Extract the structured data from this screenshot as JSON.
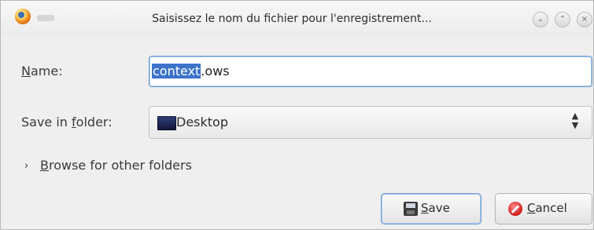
{
  "window": {
    "title": "Saisissez le nom du fichier pour l'enregistrement...",
    "controls": [
      "chevron-down-icon",
      "chevron-up-icon",
      "close-icon"
    ]
  },
  "name_row": {
    "label_mnemonic": "N",
    "label_rest": "ame:",
    "value_selected": "context",
    "value_rest": ".ows"
  },
  "folder_row": {
    "label_prefix": "Save in ",
    "label_mnemonic": "f",
    "label_rest": "older:",
    "selected": "Desktop",
    "icon": "desktop-folder-icon"
  },
  "browse": {
    "expander": "›",
    "label_mnemonic": "B",
    "label_rest": "rowse for other folders"
  },
  "buttons": {
    "save": {
      "mnemonic": "S",
      "rest": "ave",
      "icon": "floppy-disk-icon"
    },
    "cancel": {
      "mnemonic": "C",
      "rest": "ancel",
      "icon": "cancel-icon"
    }
  },
  "colors": {
    "selection": "#3c73c9",
    "focus_border": "#6c9dd3",
    "dialog_bg": "#efefef"
  }
}
